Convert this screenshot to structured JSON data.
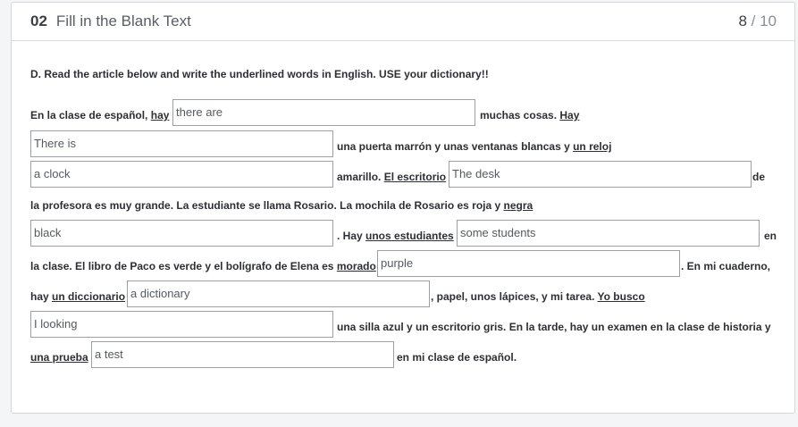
{
  "header": {
    "number": "02",
    "title": "Fill in the Blank Text",
    "current": "8",
    "separator": " / ",
    "total": "10"
  },
  "instruction": "D. Read the article below and write the underlined words in English. USE your dictionary!!",
  "text": {
    "t1": "En la clase de español, ",
    "u1": "hay",
    "t2": "muchas cosas. ",
    "u2": "Hay",
    "t3": "una puerta marrón y unas ventanas blancas y ",
    "u3": "un reloj ",
    "t4": "amarillo. ",
    "u4": "El escritorio ",
    "t5": "de",
    "t6": "la profesora es muy grande. La estudiante se llama Rosario. La mochila de Rosario es roja y ",
    "u6": "negra",
    "t7": ". Hay ",
    "u7": "unos estudiantes",
    "t8": "en",
    "t9": "la clase. El libro de Paco es verde y el bolígrafo de Elena es ",
    "u9": "morado",
    "t10": ". En mi cuaderno,",
    "t11": "hay ",
    "u11": "un diccionario ",
    "t12": ", papel, unos lápices, y mi tarea. ",
    "u12": "Yo busco",
    "t13": "una silla azul y un escritorio gris. En la tarde, hay un examen en la clase de historia y",
    "u14": "una prueba",
    "t15": "en mi  clase de español."
  },
  "answers": {
    "a1": "there are",
    "a2": "There is",
    "a3": "a clock",
    "a4": "The desk",
    "a5": "black",
    "a6": "some students",
    "a7": "purple",
    "a8": "a dictionary",
    "a9": "I looking",
    "a10": "a test"
  }
}
